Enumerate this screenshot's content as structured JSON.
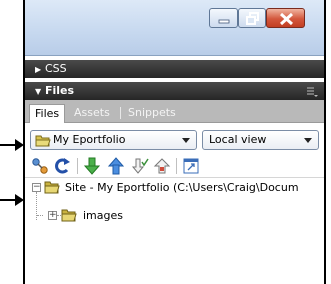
{
  "panels": {
    "css": {
      "label": "CSS"
    },
    "files": {
      "label": "Files"
    }
  },
  "tabs": [
    {
      "label": "Files",
      "active": true
    },
    {
      "label": "Assets",
      "active": false
    },
    {
      "label": "Snippets",
      "active": false
    }
  ],
  "site_select": {
    "value": "My Eportfolio"
  },
  "view_select": {
    "value": "Local view"
  },
  "tree": {
    "root_label": "Site - My Eportfolio (C:\\Users\\Craig\\Docum",
    "child_label": "images"
  },
  "colors": {
    "panel_header": "#2e2e2e",
    "folder": "#d7c34f",
    "close_button": "#c94b2e",
    "titlebar": "#c6d8ef"
  },
  "icons": [
    "minimize-icon",
    "maximize-icon",
    "close-icon",
    "connect-icon",
    "refresh-icon",
    "get-icon",
    "put-icon",
    "checkout-icon",
    "checkin-icon",
    "expand-icon",
    "folder-icon"
  ]
}
